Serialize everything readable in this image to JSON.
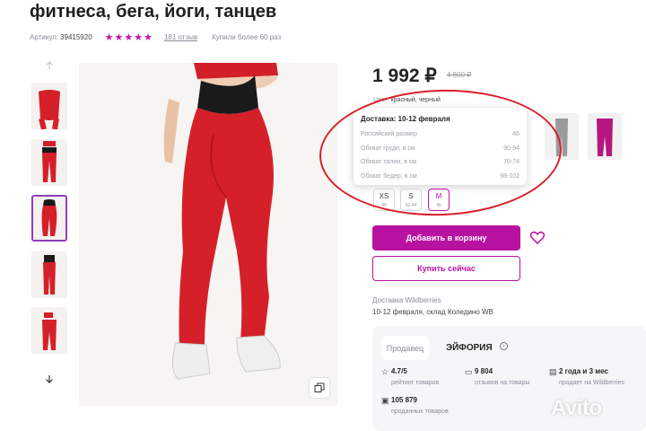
{
  "product": {
    "title": "фитнеса, бега, йоги, танцев",
    "article_label": "Артикул:",
    "article_value": "39415920",
    "stars": "★★★★★",
    "reviews": "181 отзыв",
    "bought": "Купили более 60 раз"
  },
  "price": {
    "current": "1 992 ₽",
    "old": "4 800 ₽"
  },
  "color": {
    "label": "Цвет:",
    "value": "красный, черный"
  },
  "tooltip": {
    "title": "Доставка: 10-12 февраля",
    "rows": [
      {
        "label": "Российский размер",
        "value": "46"
      },
      {
        "label": "Обхват груди, в см",
        "value": "90-94"
      },
      {
        "label": "Обхват талии, в см",
        "value": "70-74"
      },
      {
        "label": "Обхват бедер, в см",
        "value": "98-102"
      }
    ]
  },
  "sizes": [
    {
      "label": "XS",
      "sub": "40"
    },
    {
      "label": "S",
      "sub": "42-44"
    },
    {
      "label": "M",
      "sub": "46"
    }
  ],
  "buttons": {
    "add_to_cart": "Добавить в корзину",
    "buy_now": "Купить сейчас"
  },
  "delivery": {
    "label": "Доставка Wildberries",
    "value": "10-12 февраля, склад Коледино WB"
  },
  "seller": {
    "tab": "Продавец",
    "name": "ЭЙФОРИЯ",
    "stats": [
      {
        "icon": "star-icon",
        "value": "4.7/5",
        "label": "рейтинг товаров"
      },
      {
        "icon": "chat-icon",
        "value": "9 804",
        "label": "отзывов на товары"
      },
      {
        "icon": "calendar-icon",
        "value": "2 года и 3 мес",
        "label": "продает на Wildberries"
      },
      {
        "icon": "bag-icon",
        "value": "105 879",
        "label": "проданных товаров"
      }
    ]
  },
  "watermark": "Avito",
  "colors": {
    "accent": "#cb11ab",
    "button": "#b912a0",
    "annotation": "#d8202c"
  }
}
